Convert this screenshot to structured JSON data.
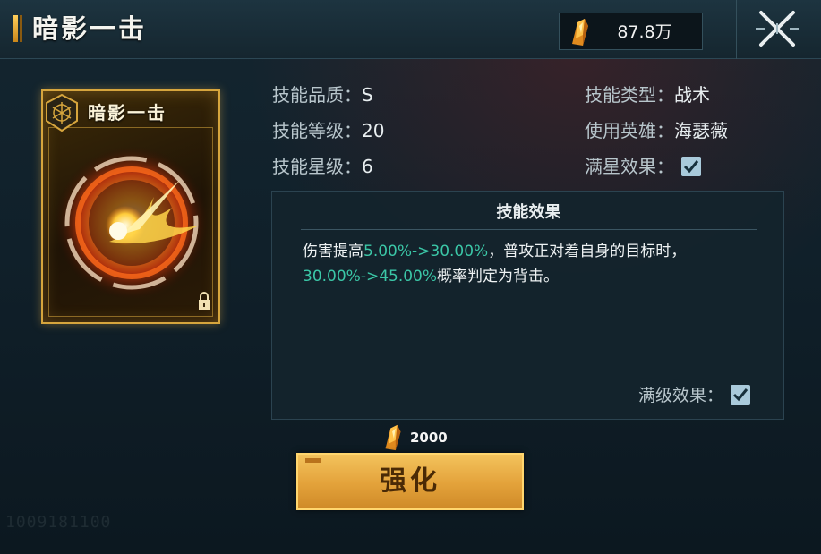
{
  "header": {
    "title": "暗影一击",
    "currency_value": "87.8万"
  },
  "card": {
    "name": "暗影一击"
  },
  "attributes": {
    "quality_label": "技能品质：",
    "quality_value": "S",
    "level_label": "技能等级：",
    "level_value": "20",
    "star_label": "技能星级：",
    "star_value": "6",
    "type_label": "技能类型：",
    "type_value": "战术",
    "hero_label": "使用英雄：",
    "hero_value": "海瑟薇",
    "max_star_label": "满星效果：",
    "max_star_checked": true
  },
  "effect": {
    "title": "技能效果",
    "text_1": "伤害提高",
    "hl_1": "5.00%->30.00%",
    "text_2": "，普攻正对着自身的目标时，",
    "hl_2": "30.00%->45.00%",
    "text_3": "概率判定为背击。",
    "max_level_label": "满级效果：",
    "max_level_checked": true
  },
  "upgrade": {
    "cost": "2000",
    "button_label": "强化"
  },
  "watermark": "1009181100"
}
